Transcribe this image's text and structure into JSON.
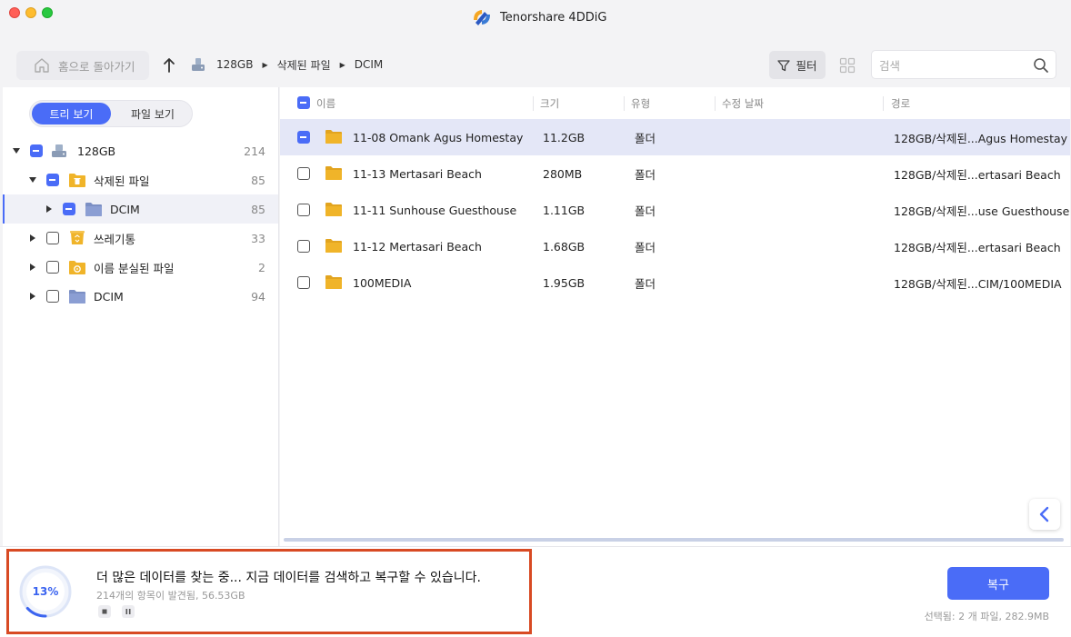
{
  "app": {
    "title": "Tenorshare 4DDiG"
  },
  "toolbar": {
    "home_label": "홈으로 돌아가기",
    "breadcrumb": [
      "128GB",
      "삭제된 파일",
      "DCIM"
    ],
    "filter_label": "필터",
    "search_placeholder": "검색"
  },
  "left": {
    "tabs": [
      "트리 보기",
      "파일 보기"
    ],
    "tree": [
      {
        "label": "128GB",
        "count": "214",
        "icon": "drive-icon",
        "expanded": true,
        "checked": "partial"
      },
      {
        "label": "삭제된 파일",
        "count": "85",
        "icon": "deleted-folder-icon",
        "expanded": true,
        "checked": "partial"
      },
      {
        "label": "DCIM",
        "count": "85",
        "icon": "folder-icon",
        "expanded": false,
        "checked": "partial",
        "selected": true
      },
      {
        "label": "쓰레기통",
        "count": "33",
        "icon": "trash-folder-icon",
        "expanded": false,
        "checked": "none"
      },
      {
        "label": "이름 분실된 파일",
        "count": "2",
        "icon": "lost-folder-icon",
        "expanded": false,
        "checked": "none"
      },
      {
        "label": "DCIM",
        "count": "94",
        "icon": "folder-icon",
        "expanded": false,
        "checked": "none"
      }
    ]
  },
  "table": {
    "columns": [
      "이름",
      "크기",
      "유형",
      "수정 날짜",
      "경로"
    ],
    "rows": [
      {
        "name": "11-08 Omank Agus Homestay",
        "size": "11.2GB",
        "type": "폴더",
        "date": "",
        "path": "128GB/삭제된...Agus Homestay",
        "checked": "partial"
      },
      {
        "name": "11-13 Mertasari Beach",
        "size": "280MB",
        "type": "폴더",
        "date": "",
        "path": "128GB/삭제된...ertasari Beach",
        "checked": "none"
      },
      {
        "name": "11-11 Sunhouse Guesthouse",
        "size": "1.11GB",
        "type": "폴더",
        "date": "",
        "path": "128GB/삭제된...use Guesthouse",
        "checked": "none"
      },
      {
        "name": "11-12 Mertasari Beach",
        "size": "1.68GB",
        "type": "폴더",
        "date": "",
        "path": "128GB/삭제된...ertasari Beach",
        "checked": "none"
      },
      {
        "name": "100MEDIA",
        "size": "1.95GB",
        "type": "폴더",
        "date": "",
        "path": "128GB/삭제된...CIM/100MEDIA",
        "checked": "none"
      }
    ]
  },
  "status": {
    "progress_percent": 13,
    "progress_label": "13%",
    "message": "더 많은 데이터를 찾는 중... 지금 데이터를 검색하고 복구할 수 있습니다.",
    "found": "214개의 항목이 발견됨, 56.53GB",
    "recover_label": "복구",
    "selection": "선택됨: 2 개 파일, 282.9MB"
  },
  "colors": {
    "accent": "#4a6cf7",
    "highlight_border": "#d84a23",
    "folder": "#f0b429"
  }
}
